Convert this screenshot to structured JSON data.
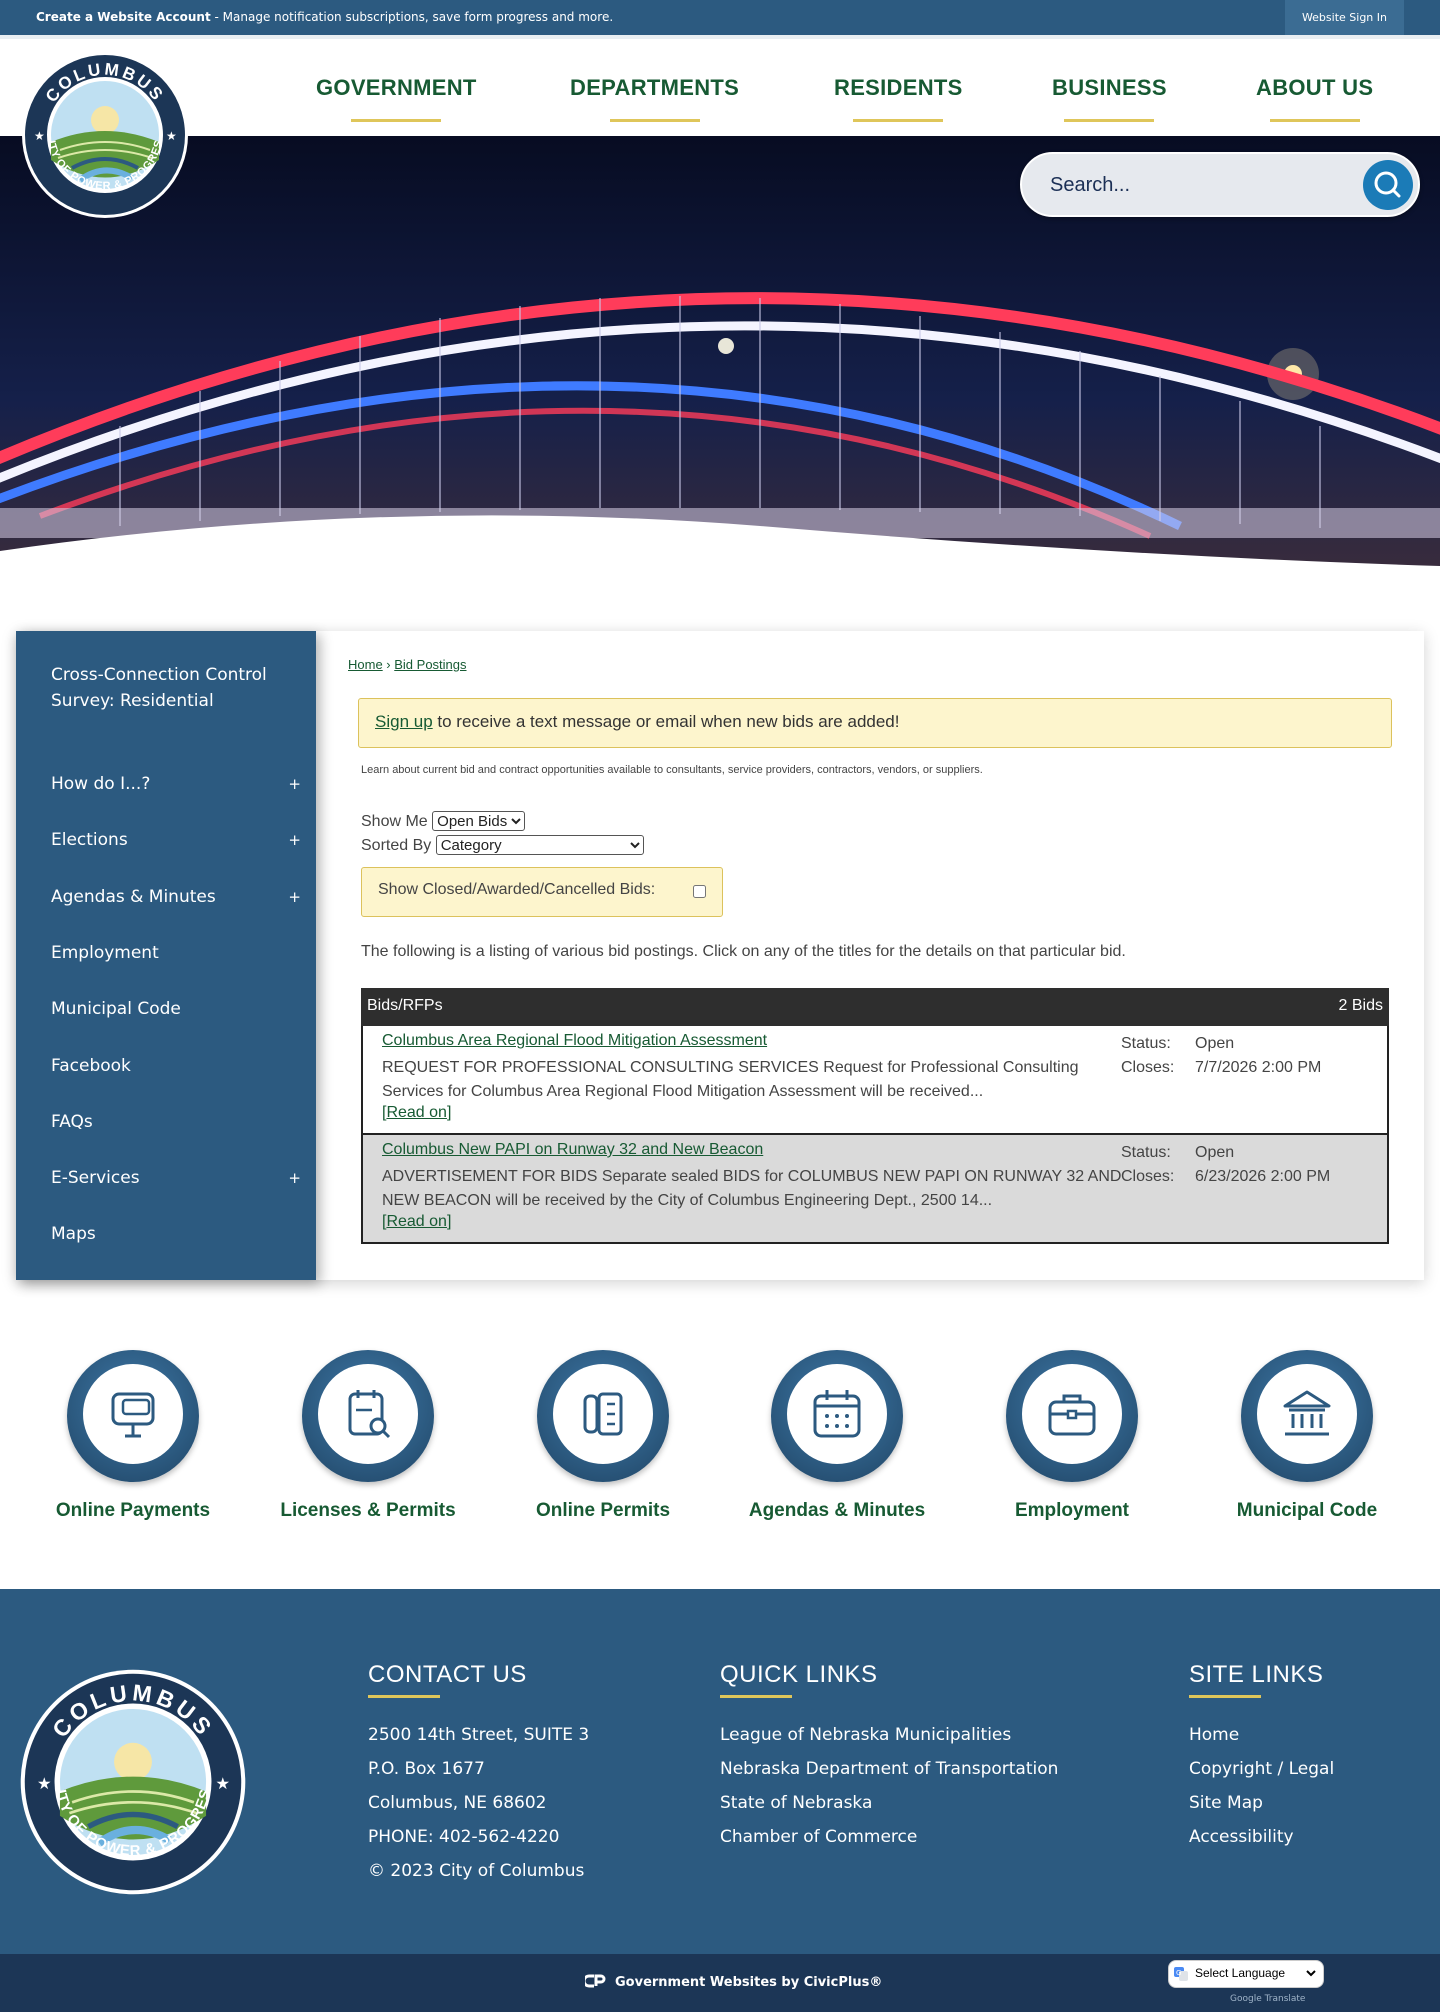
{
  "topbar": {
    "account_link": "Create a Website Account",
    "account_msg": " - Manage notification subscriptions, save form progress and more.",
    "signin": "Website Sign In"
  },
  "logo": {
    "top_text": "COLUMBUS",
    "bottom_text": "CITY OF POWER & PROGRESS",
    "icon": "city-seal"
  },
  "nav": [
    "GOVERNMENT",
    "DEPARTMENTS",
    "RESIDENTS",
    "BUSINESS",
    "ABOUT US"
  ],
  "search": {
    "placeholder": "Search..."
  },
  "sidebar": {
    "items": [
      {
        "label": "Cross-Connection Control Survey: Residential",
        "expand": ""
      },
      {
        "label": "How do I...?",
        "expand": "+"
      },
      {
        "label": "Elections",
        "expand": "+"
      },
      {
        "label": "Agendas & Minutes",
        "expand": "+"
      },
      {
        "label": "Employment",
        "expand": ""
      },
      {
        "label": "Municipal Code",
        "expand": ""
      },
      {
        "label": "Facebook",
        "expand": ""
      },
      {
        "label": "FAQs",
        "expand": ""
      },
      {
        "label": "E-Services",
        "expand": "+"
      },
      {
        "label": "Maps",
        "expand": ""
      }
    ]
  },
  "breadcrumb": {
    "home": "Home",
    "sep": " › ",
    "current": "Bid Postings"
  },
  "alert": {
    "link": "Sign up",
    "text": " to receive a text message or email when new bids are added!"
  },
  "intro": "Learn about current bid and contract opportunities available to consultants, service providers, contractors, vendors, or suppliers.",
  "filters": {
    "show_label": "Show Me",
    "show_value": "Open Bids",
    "sort_label": "Sorted By",
    "sort_value": "Category",
    "closed_label": "Show Closed/Awarded/Cancelled Bids:"
  },
  "listing_text": "The following is a listing of various bid postings. Click on any of the titles for the details on that particular bid.",
  "bids": {
    "header": "Bids/RFPs",
    "count": "2 Bids",
    "status_key": "Status:",
    "closes_key": "Closes:",
    "read_on": "Read on",
    "items": [
      {
        "title": "Columbus Area Regional Flood Mitigation Assessment",
        "desc": "REQUEST FOR PROFESSIONAL CONSULTING SERVICES Request for Professional Consulting Services for Columbus Area Regional Flood Mitigation Assessment will be received...",
        "status": "Open",
        "closes": "7/7/2026 2:00 PM"
      },
      {
        "title": "Columbus New PAPI on Runway 32 and New Beacon",
        "desc": "ADVERTISEMENT FOR BIDS Separate sealed BIDS for COLUMBUS NEW PAPI ON RUNWAY 32 AND NEW BEACON will be received by the City of Columbus Engineering Dept., 2500 14...",
        "status": "Open",
        "closes": "6/23/2026 2:00 PM"
      }
    ]
  },
  "quick_links": [
    {
      "label": "Online Payments",
      "icon": "computer-payment-icon"
    },
    {
      "label": "Licenses & Permits",
      "icon": "document-search-icon"
    },
    {
      "label": "Online Permits",
      "icon": "permits-icon"
    },
    {
      "label": "Agendas & Minutes",
      "icon": "calendar-icon"
    },
    {
      "label": "Employment",
      "icon": "briefcase-icon"
    },
    {
      "label": "Municipal Code",
      "icon": "building-icon"
    }
  ],
  "footer": {
    "contact": {
      "title": "CONTACT US",
      "lines": [
        "2500 14th Street, SUITE 3",
        "P.O. Box 1677",
        "Columbus, NE 68602",
        "PHONE: 402-562-4220",
        "© 2023 City of Columbus"
      ]
    },
    "quick": {
      "title": "QUICK LINKS",
      "lines": [
        "League of Nebraska Municipalities",
        "Nebraska Department of Transportation",
        "State of Nebraska",
        "Chamber of Commerce"
      ]
    },
    "site": {
      "title": "SITE LINKS",
      "lines": [
        "Home",
        "Copyright / Legal",
        "Site Map",
        "Accessibility"
      ]
    }
  },
  "bottom": {
    "civicplus": "Government Websites by CivicPlus®",
    "language": "Select Language",
    "powered": "Google Translate"
  },
  "colors": {
    "primary_blue": "#2c5a80",
    "nav_green": "#175a33",
    "gold": "#dfc65a",
    "alert_bg": "#fdf5cd"
  }
}
